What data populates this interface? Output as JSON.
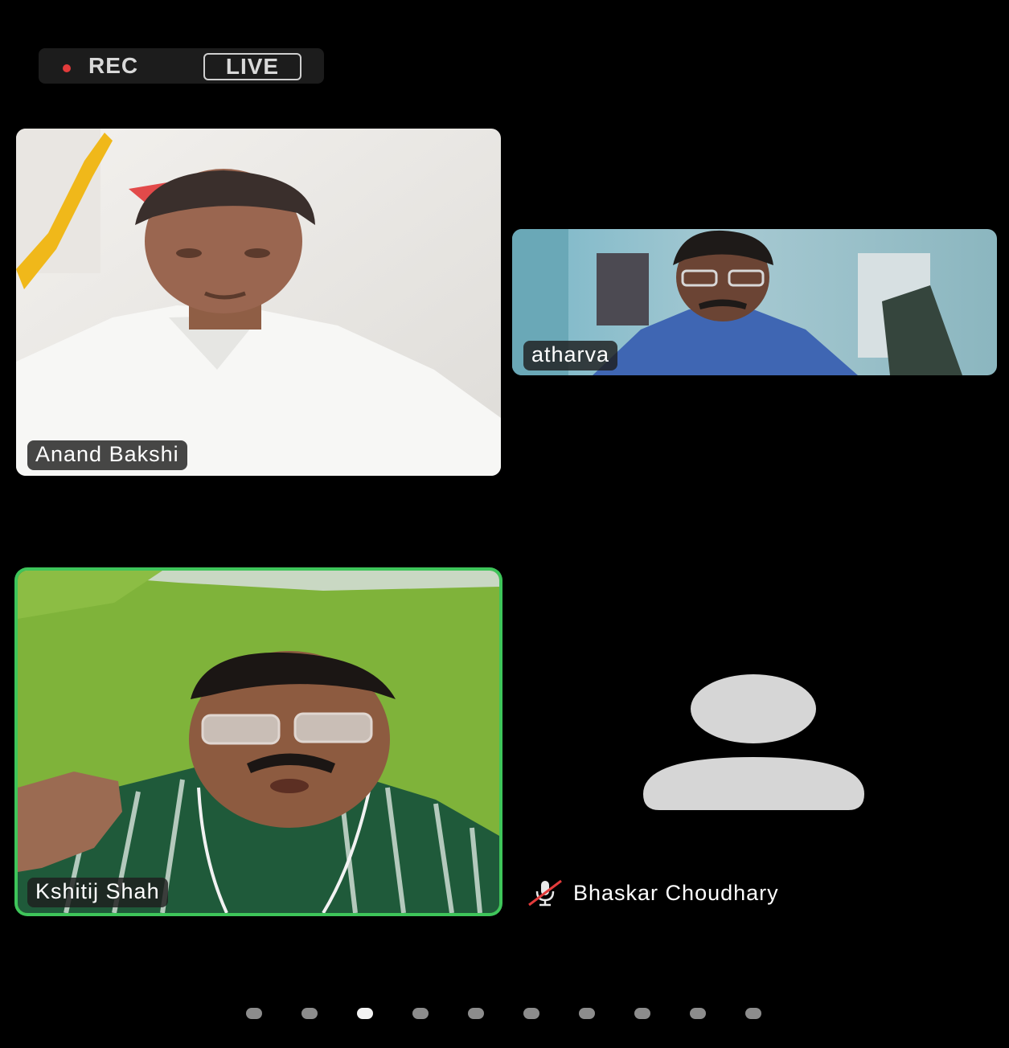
{
  "status": {
    "rec_label": "REC",
    "live_label": "LIVE"
  },
  "participants": [
    {
      "name": "Anand Bakshi",
      "video": true,
      "speaking": false
    },
    {
      "name": "atharva",
      "video": true,
      "speaking": false
    },
    {
      "name": "Kshitij Shah",
      "video": true,
      "speaking": true
    },
    {
      "name": "Bhaskar Choudhary",
      "video": false,
      "muted": true
    }
  ],
  "pager": {
    "total_pages": 10,
    "current_page": 3
  },
  "colors": {
    "background": "#000000",
    "active_speaker_border": "#3ec55a",
    "rec_dot": "#e23b3b",
    "avatar": "#d6d6d6",
    "mute_slash": "#e23b3b"
  },
  "icons": [
    "rec-dot-icon",
    "avatar-placeholder-icon",
    "mic-muted-icon"
  ]
}
